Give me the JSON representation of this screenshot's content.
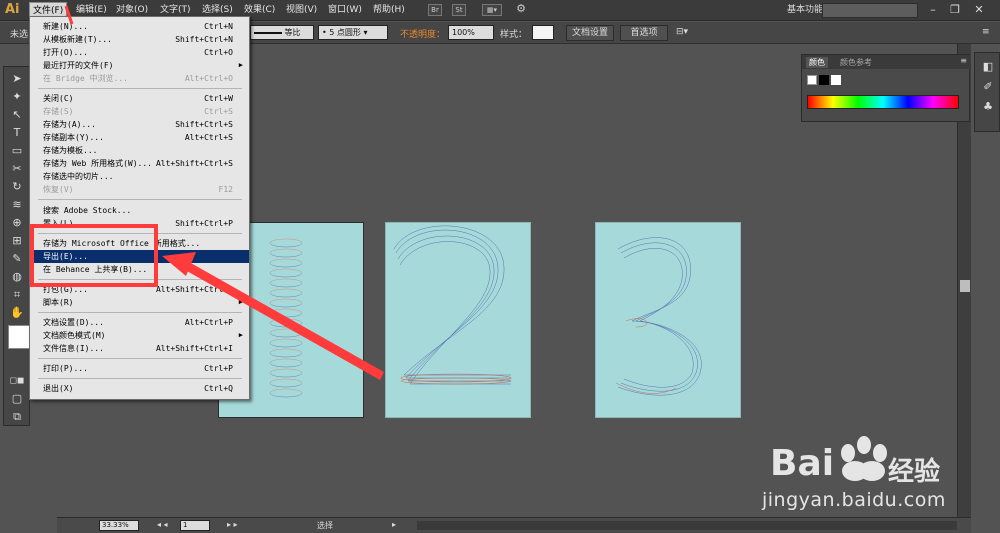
{
  "app": {
    "logo": "Ai"
  },
  "menubar": {
    "items": [
      {
        "label": "文件(F)"
      },
      {
        "label": "编辑(E)"
      },
      {
        "label": "对象(O)"
      },
      {
        "label": "文字(T)"
      },
      {
        "label": "选择(S)"
      },
      {
        "label": "效果(C)"
      },
      {
        "label": "视图(V)"
      },
      {
        "label": "窗口(W)"
      },
      {
        "label": "帮助(H)"
      }
    ],
    "icon_br": "Br",
    "icon_st": "St",
    "workspace": "基本功能"
  },
  "controlbar": {
    "left_label": "未选",
    "stroke_style": "等比",
    "brush": "5 点圆形",
    "opacity_label": "不透明度：",
    "opacity_value": "100%",
    "style_label": "样式：",
    "doc_setup": "文档设置",
    "prefs": "首选项"
  },
  "file_menu": {
    "items": [
      {
        "label": "新建(N)...",
        "shortcut": "Ctrl+N"
      },
      {
        "label": "从模板新建(T)...",
        "shortcut": "Shift+Ctrl+N"
      },
      {
        "label": "打开(O)...",
        "shortcut": "Ctrl+O"
      },
      {
        "label": "最近打开的文件(F)",
        "shortcut": ""
      },
      {
        "label": "在 Bridge 中浏览...",
        "shortcut": "Alt+Ctrl+O"
      },
      {
        "label": "关闭(C)",
        "shortcut": "Ctrl+W"
      },
      {
        "label": "存储(S)",
        "shortcut": "Ctrl+S"
      },
      {
        "label": "存储为(A)...",
        "shortcut": "Shift+Ctrl+S"
      },
      {
        "label": "存储副本(Y)...",
        "shortcut": "Alt+Ctrl+S"
      },
      {
        "label": "存储为模板...",
        "shortcut": ""
      },
      {
        "label": "存储为 Web 所用格式(W)...",
        "shortcut": "Alt+Shift+Ctrl+S"
      },
      {
        "label": "存储选中的切片...",
        "shortcut": ""
      },
      {
        "label": "恢复(V)",
        "shortcut": "F12"
      },
      {
        "label": "搜索 Adobe Stock...",
        "shortcut": ""
      },
      {
        "label": "置入(L)...",
        "shortcut": "Shift+Ctrl+P"
      },
      {
        "label": "存储为 Microsoft Office 所用格式...",
        "shortcut": ""
      },
      {
        "label": "导出(E)...",
        "shortcut": ""
      },
      {
        "label": "在 Behance 上共享(B)...",
        "shortcut": ""
      },
      {
        "label": "打包(G)...",
        "shortcut": "Alt+Shift+Ctrl+P"
      },
      {
        "label": "脚本(R)",
        "shortcut": ""
      },
      {
        "label": "文档设置(D)...",
        "shortcut": "Alt+Ctrl+P"
      },
      {
        "label": "文档颜色模式(M)",
        "shortcut": ""
      },
      {
        "label": "文件信息(I)...",
        "shortcut": "Alt+Shift+Ctrl+I"
      },
      {
        "label": "打印(P)...",
        "shortcut": "Ctrl+P"
      },
      {
        "label": "退出(X)",
        "shortcut": "Ctrl+Q"
      }
    ]
  },
  "color_panel": {
    "tab_color": "颜色",
    "tab_guide": "颜色参考"
  },
  "statusbar": {
    "zoom": "33.33%",
    "page": "1",
    "tool": "选择"
  },
  "watermark": {
    "brand": "Bai",
    "brand_cn": "经验",
    "url": "jingyan.baidu.com"
  },
  "colors": {
    "artboard": "#a6dada",
    "highlight": "#0a2e6c",
    "annotation": "#ff3b3b"
  }
}
